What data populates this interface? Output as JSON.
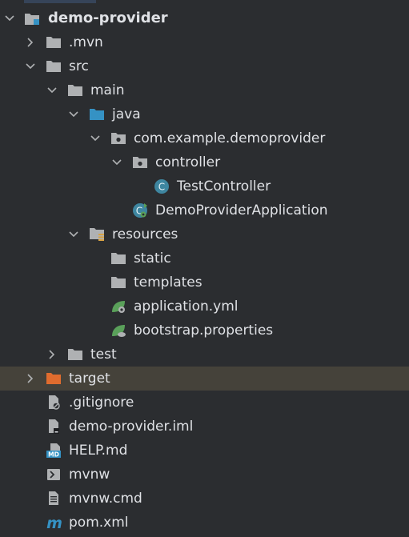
{
  "colors": {
    "background": "#2b2d30",
    "highlight_row": "#45423a",
    "folder_gray": "#afb1b3",
    "folder_blue": "#3592c4",
    "folder_orange": "#e06c2e",
    "class_teal": "#3e86a0",
    "spring_green": "#5aa05a",
    "text": "#dfe1e5"
  },
  "tree": [
    {
      "label": "demo-provider",
      "icon": "module-folder-icon",
      "expanded": true
    },
    {
      "label": ".mvn",
      "icon": "folder-icon",
      "expanded": false
    },
    {
      "label": "src",
      "icon": "folder-icon",
      "expanded": true
    },
    {
      "label": "main",
      "icon": "folder-icon",
      "expanded": true
    },
    {
      "label": "java",
      "icon": "source-folder-icon",
      "expanded": true
    },
    {
      "label": "com.example.demoprovider",
      "icon": "package-icon",
      "expanded": true
    },
    {
      "label": "controller",
      "icon": "package-icon",
      "expanded": true
    },
    {
      "label": "TestController",
      "icon": "class-icon"
    },
    {
      "label": "DemoProviderApplication",
      "icon": "spring-boot-class-icon"
    },
    {
      "label": "resources",
      "icon": "resources-folder-icon",
      "expanded": true
    },
    {
      "label": "static",
      "icon": "folder-icon"
    },
    {
      "label": "templates",
      "icon": "folder-icon"
    },
    {
      "label": "application.yml",
      "icon": "spring-config-icon"
    },
    {
      "label": "bootstrap.properties",
      "icon": "spring-properties-icon"
    },
    {
      "label": "test",
      "icon": "folder-icon",
      "expanded": false
    },
    {
      "label": "target",
      "icon": "excluded-folder-icon",
      "expanded": false
    },
    {
      "label": ".gitignore",
      "icon": "ignored-file-icon"
    },
    {
      "label": "demo-provider.iml",
      "icon": "iml-file-icon"
    },
    {
      "label": "HELP.md",
      "icon": "markdown-file-icon"
    },
    {
      "label": "mvnw",
      "icon": "shell-script-icon"
    },
    {
      "label": "mvnw.cmd",
      "icon": "text-file-icon"
    },
    {
      "label": "pom.xml",
      "icon": "maven-pom-icon"
    }
  ]
}
